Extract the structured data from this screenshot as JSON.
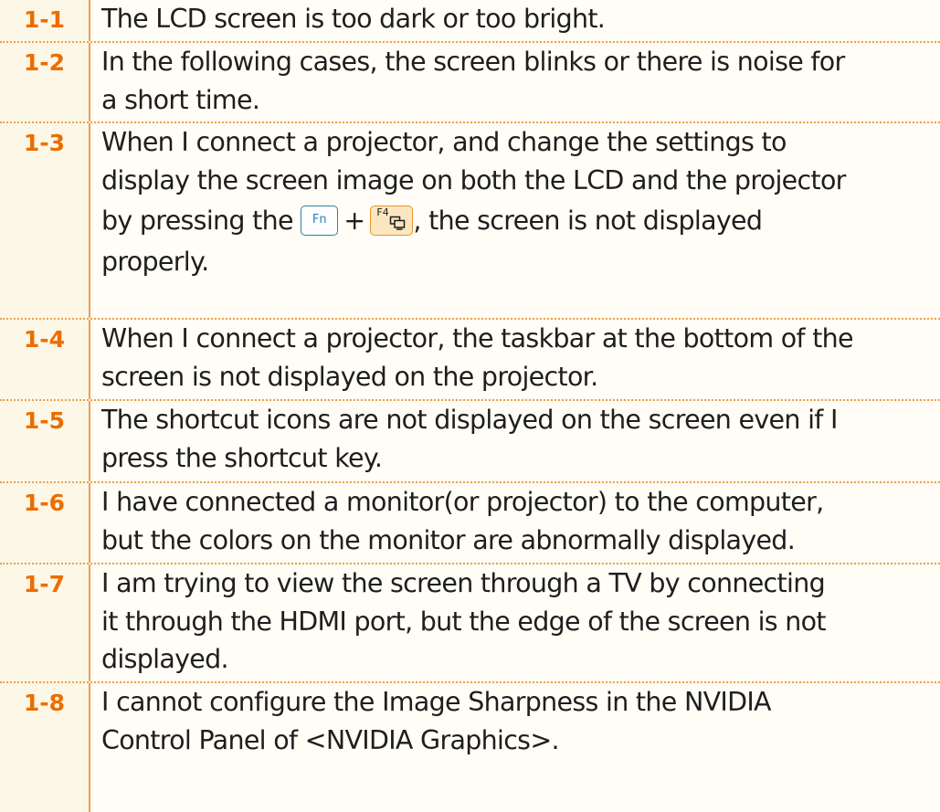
{
  "faq": {
    "items": [
      {
        "num": "1-1",
        "lines": [
          "The LCD screen is too dark or too bright."
        ]
      },
      {
        "num": "1-2",
        "lines": [
          "In the following cases, the screen blinks or there is noise for",
          "a short time."
        ]
      },
      {
        "num": "1-3",
        "lines": [
          "When I connect a projector, and change the settings to",
          "display the screen image on both the LCD and the projector"
        ],
        "key_line_before": "by pressing the",
        "key_fn_label": "Fn",
        "key_plus": "+",
        "key_f4_label": "F4",
        "key_line_after": ", the screen is not displayed",
        "last_line": "properly."
      },
      {
        "num": "1-4",
        "lines": [
          "When I connect a projector, the taskbar at the bottom of the",
          "screen is not displayed on the projector."
        ]
      },
      {
        "num": "1-5",
        "lines": [
          "The shortcut icons are not displayed on the screen even if I",
          "press the shortcut key."
        ]
      },
      {
        "num": "1-6",
        "lines": [
          "I have connected a monitor(or projector) to the computer,",
          "but the colors on the monitor are abnormally displayed."
        ]
      },
      {
        "num": "1-7",
        "lines": [
          "I am trying to view the screen through a TV by connecting",
          "it through the HDMI port, but the edge of the screen is not",
          "displayed."
        ]
      },
      {
        "num": "1-8",
        "lines": [
          "I cannot configure the Image Sharpness in the NVIDIA",
          "Control Panel of <NVIDIA Graphics>."
        ]
      }
    ]
  },
  "icons": {
    "f4_key_glyph": "display-switch-icon"
  },
  "colors": {
    "number": "#ec6d00",
    "divider": "#e8a254",
    "fn_key_border": "#2a7fb0",
    "f4_key_fill": "#fbe6c0"
  }
}
